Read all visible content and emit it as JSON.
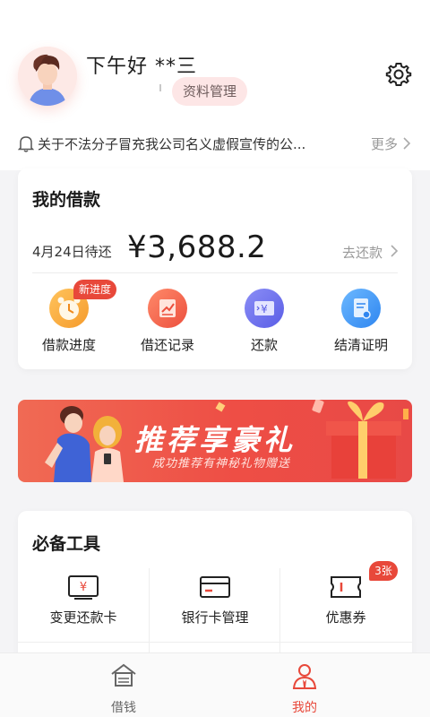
{
  "header": {
    "greeting": "下午好  **三",
    "profile_button": "资料管理"
  },
  "notice": {
    "text": "关于不法分子冒充我公司名义虚假宣传的公...",
    "more_label": "更多"
  },
  "loan": {
    "title": "我的借款",
    "due_date": "4月24日待还",
    "amount": "¥3,688.2",
    "repay_label": "去还款",
    "actions": [
      {
        "label": "借款进度",
        "icon": "alarm-clock-icon",
        "badge": "新进度"
      },
      {
        "label": "借还记录",
        "icon": "record-icon"
      },
      {
        "label": "还款",
        "icon": "yen-card-icon"
      },
      {
        "label": "结清证明",
        "icon": "certificate-icon"
      }
    ]
  },
  "banner": {
    "title": "推荐享豪礼",
    "subtitle": "成功推荐有神秘礼物赠送"
  },
  "tools": {
    "title": "必备工具",
    "items": [
      {
        "label": "变更还款卡",
        "icon": "yen-card-icon"
      },
      {
        "label": "银行卡管理",
        "icon": "bank-card-icon"
      },
      {
        "label": "优惠券",
        "icon": "coupon-icon",
        "badge": "3张"
      }
    ]
  },
  "tabbar": {
    "items": [
      {
        "label": "借钱",
        "icon": "house-icon",
        "active": false
      },
      {
        "label": "我的",
        "icon": "person-icon",
        "active": true
      }
    ]
  },
  "colors": {
    "accent": "#e8483a",
    "active_tab": "#e8483a",
    "inactive_tab": "#666666"
  }
}
